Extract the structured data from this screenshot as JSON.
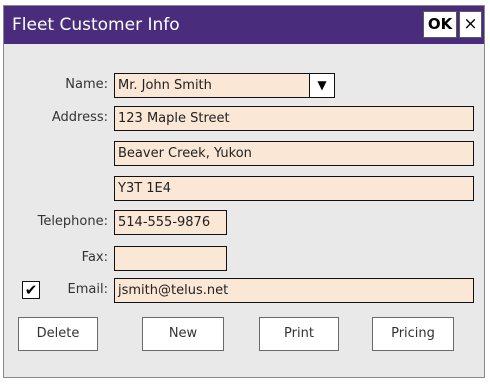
{
  "window": {
    "title": "Fleet Customer Info",
    "ok_label": "OK",
    "close_label": "×"
  },
  "form": {
    "name_label": "Name:",
    "name_value": "Mr. John Smith",
    "name_dropdown_icon": "▼",
    "address_label": "Address:",
    "address_line1": "123 Maple Street",
    "address_line2": "Beaver Creek, Yukon",
    "address_line3": "Y3T 1E4",
    "telephone_label": "Telephone:",
    "telephone_value": "514-555-9876",
    "fax_label": "Fax:",
    "fax_value": "",
    "email_checked_mark": "✔",
    "email_label": "Email:",
    "email_value": "jsmith@telus.net"
  },
  "buttons": {
    "delete": "Delete",
    "new": "New",
    "print": "Print",
    "pricing": "Pricing"
  },
  "colors": {
    "titlebar": "#4a2c7c",
    "field_background": "#fbe7d6",
    "window_background": "#e9e9e9"
  }
}
